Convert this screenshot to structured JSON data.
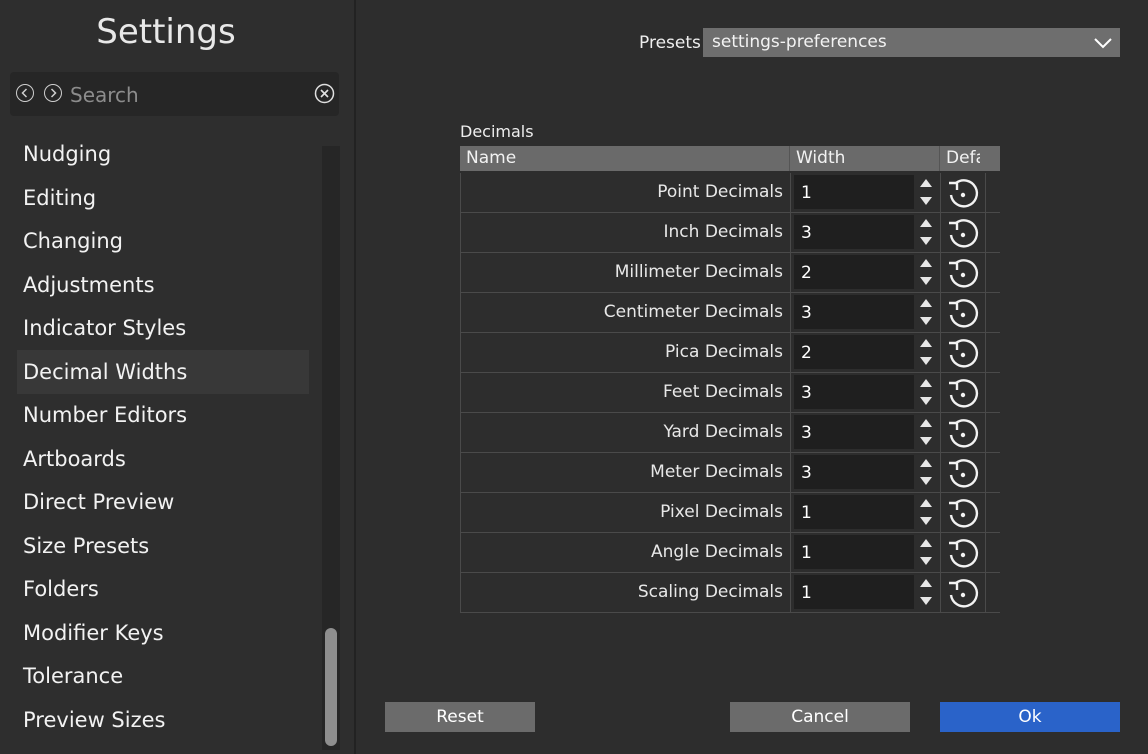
{
  "sidebar": {
    "title": "Settings",
    "search": {
      "placeholder": "Search",
      "value": ""
    },
    "items": [
      "Nudging",
      "Editing",
      "Changing",
      "Adjustments",
      "Indicator Styles",
      "Decimal Widths",
      "Number Editors",
      "Artboards",
      "Direct Preview",
      "Size Presets",
      "Folders",
      "Modifier Keys",
      "Tolerance",
      "Preview Sizes"
    ],
    "active_item": "Decimal Widths"
  },
  "presets": {
    "label": "Presets",
    "value": "settings-preferences"
  },
  "decimals": {
    "group_label": "Decimals",
    "columns": [
      "Name",
      "Width",
      "Defa"
    ],
    "rows": [
      {
        "name": "Point Decimals",
        "width": "1"
      },
      {
        "name": "Inch Decimals",
        "width": "3"
      },
      {
        "name": "Millimeter Decimals",
        "width": "2"
      },
      {
        "name": "Centimeter Decimals",
        "width": "3"
      },
      {
        "name": "Pica Decimals",
        "width": "2"
      },
      {
        "name": "Feet Decimals",
        "width": "3"
      },
      {
        "name": "Yard Decimals",
        "width": "3"
      },
      {
        "name": "Meter Decimals",
        "width": "3"
      },
      {
        "name": "Pixel Decimals",
        "width": "1"
      },
      {
        "name": "Angle Decimals",
        "width": "1"
      },
      {
        "name": "Scaling Decimals",
        "width": "1"
      }
    ]
  },
  "buttons": {
    "reset": "Reset",
    "cancel": "Cancel",
    "ok": "Ok"
  },
  "colors": {
    "accent": "#2a63c9",
    "panel": "#2e2e2e",
    "field": "#1f1f1f"
  }
}
